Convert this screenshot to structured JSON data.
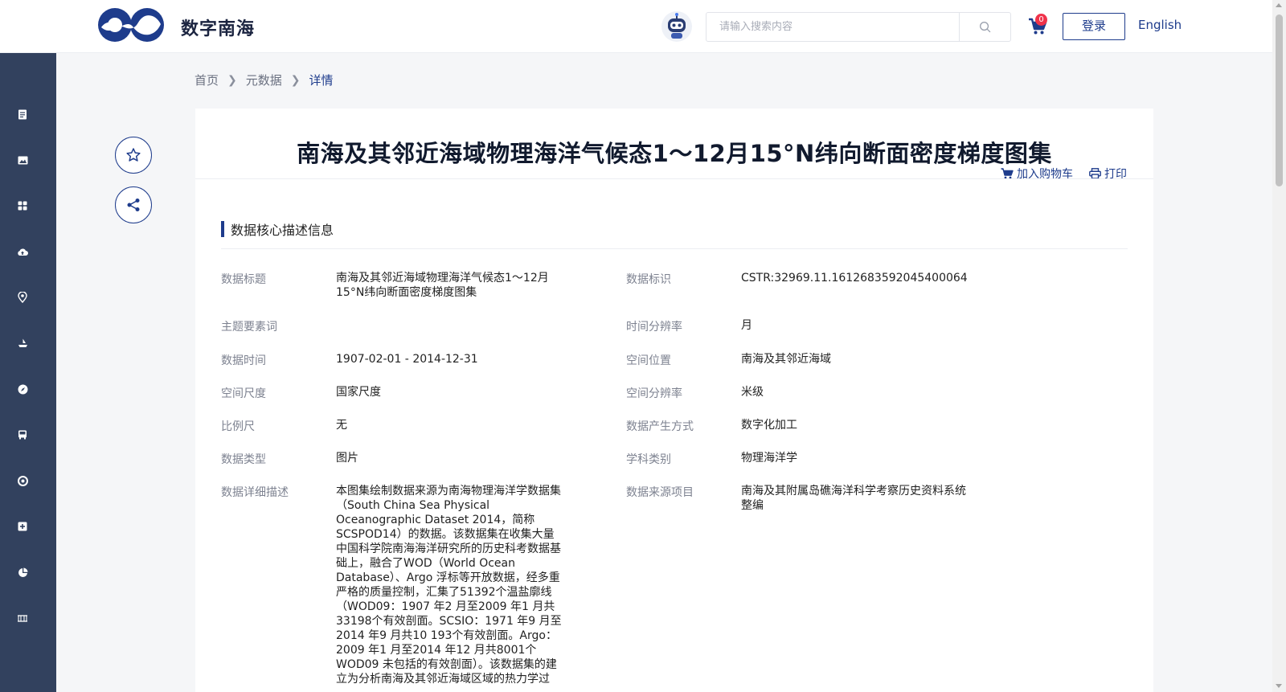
{
  "header": {
    "brand": "数字南海",
    "search_placeholder": "请输入搜索内容",
    "cart_count": "0",
    "login_label": "登录",
    "language_label": "English"
  },
  "breadcrumb": [
    "首页",
    "元数据",
    "详情"
  ],
  "detail": {
    "title": "南海及其邻近海域物理海洋气候态1～12月15°N纬向断面密度梯度图集",
    "add_to_cart": "加入购物车",
    "print": "打印",
    "section_title": "数据核心描述信息"
  },
  "fields": {
    "data_title": {
      "label": "数据标题",
      "value": "南海及其邻近海域物理海洋气候态1～12月15°N纬向断面密度梯度图集"
    },
    "data_id": {
      "label": "数据标识",
      "value": "CSTR:32969.11.1612683592045400064"
    },
    "keywords": {
      "label": "主题要素词",
      "value": ""
    },
    "time_resolution": {
      "label": "时间分辨率",
      "value": "月"
    },
    "data_time": {
      "label": "数据时间",
      "value": "1907-02-01 - 2014-12-31"
    },
    "location": {
      "label": "空间位置",
      "value": "南海及其邻近海域"
    },
    "spatial_scale": {
      "label": "空间尺度",
      "value": "国家尺度"
    },
    "spatial_resolution": {
      "label": "空间分辨率",
      "value": "米级"
    },
    "scale": {
      "label": "比例尺",
      "value": "无"
    },
    "production_method": {
      "label": "数据产生方式",
      "value": "数字化加工"
    },
    "data_type": {
      "label": "数据类型",
      "value": "图片"
    },
    "discipline": {
      "label": "学科类别",
      "value": "物理海洋学"
    },
    "description": {
      "label": "数据详细描述",
      "value": "本图集绘制数据来源为南海物理海洋学数据集（South China Sea Physical Oceanographic Dataset 2014，简称SCSPOD14）的数据。该数据集在收集大量中国科学院南海海洋研究所的历史科考数据基础上，融合了WOD（World Ocean Database）、Argo 浮标等开放数据，经多重严格的质量控制，汇集了51392个温盐廓线（WOD09：1907 年2 月至2009 年1 月共33198个有效剖面。SCSIO：1971 年9 月至2014 年9 月共10 193个有效剖面。Argo：2009 年1 月至2014 年12 月共8001个WOD09 未包括的有效剖面）。该数据集的建立为分析南海及其邻近海域区域的热力学过"
    },
    "source_project": {
      "label": "数据来源项目",
      "value": "南海及其附属岛礁海洋科学考察历史资料系统整编"
    }
  },
  "colors": {
    "primary": "#1e3c8c",
    "sidebar": "#32415e",
    "badge": "#f0334b"
  },
  "sidebar_icons": [
    "document-icon",
    "image-icon",
    "grid-icon",
    "cloud-upload-icon",
    "location-pin-icon",
    "ship-icon",
    "compass-icon",
    "bus-icon",
    "lifebuoy-icon",
    "add-box-icon",
    "pie-chart-icon",
    "bridge-icon"
  ]
}
